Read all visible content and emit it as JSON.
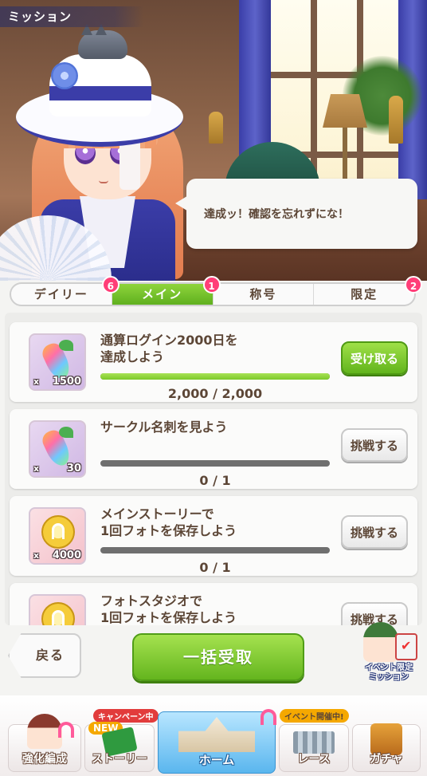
{
  "screen": {
    "title": "ミッション"
  },
  "speech": {
    "text": "達成ッ！確認を忘れずにな！"
  },
  "tabs": [
    {
      "label": "デイリー",
      "badge": "6",
      "active": false
    },
    {
      "label": "メイン",
      "badge": "1",
      "active": true
    },
    {
      "label": "称号",
      "badge": "",
      "active": false
    },
    {
      "label": "限定",
      "badge": "2",
      "active": false
    }
  ],
  "missions": [
    {
      "title": "通算ログイン2000日を\n達成しよう",
      "reward_icon": "rainbow-carrot-icon",
      "reward_qty": "1500",
      "progress_text": "2,000 / 2,000",
      "progress_ratio": 1.0,
      "action": "受け取る",
      "action_type": "claim"
    },
    {
      "title": "サークル名刺を見よう",
      "reward_icon": "rainbow-carrot-icon",
      "reward_qty": "30",
      "progress_text": "0 / 1",
      "progress_ratio": 0.0,
      "action": "挑戦する",
      "action_type": "challenge"
    },
    {
      "title": "メインストーリーで\n1回フォトを保存しよう",
      "reward_icon": "gold-coin-icon",
      "reward_qty": "4000",
      "progress_text": "0 / 1",
      "progress_ratio": 0.0,
      "action": "挑戦する",
      "action_type": "challenge"
    },
    {
      "title": "フォトスタジオで\n1回フォトを保存しよう",
      "reward_icon": "gold-coin-icon",
      "reward_qty": "",
      "progress_text": "",
      "progress_ratio": 0.0,
      "action": "挑戦する",
      "action_type": "challenge"
    }
  ],
  "qty_prefix": "x",
  "buttons": {
    "back": "戻る",
    "bulk_claim": "一括受取"
  },
  "event_mission": {
    "label_line1": "イベント限定",
    "label_line2": "ミッション"
  },
  "nav": [
    {
      "label": "強化編成",
      "ribbon": ""
    },
    {
      "label": "ストーリー",
      "ribbon": "キャンペーン中",
      "ribbon2": "NEW"
    },
    {
      "label": "ホーム",
      "ribbon": ""
    },
    {
      "label": "レース",
      "ribbon": "イベント開催中!"
    },
    {
      "label": "ガチャ",
      "ribbon": ""
    }
  ],
  "colors": {
    "accent_green": "#6fbf24",
    "badge_pink": "#ff3e78",
    "text_brown": "#5c4636"
  }
}
